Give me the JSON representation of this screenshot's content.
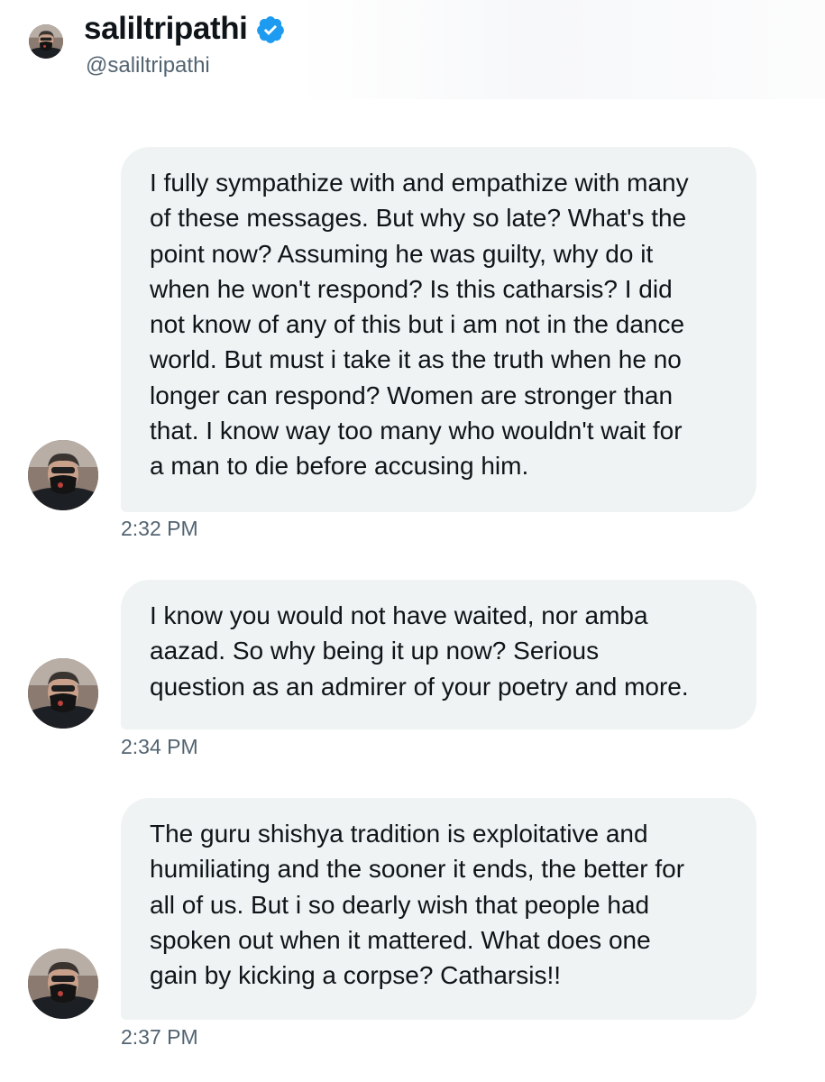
{
  "header": {
    "display_name": "saliltripathi",
    "handle": "@saliltripathi",
    "verified_icon": "verified-badge-icon"
  },
  "messages": [
    {
      "text": "I fully sympathize with and empathize with many\nof these messages. But why so late? What's the\npoint now? Assuming he was guilty, why do it\nwhen he won't respond? Is this catharsis? I did\nnot know of any of this but i am not in the dance\nworld. But must i take it as the truth when he no\nlonger can respond? Women are stronger than\nthat. I know way too many who wouldn't wait for\na man to die before accusing him.",
      "time": "2:32 PM"
    },
    {
      "text": "I know you would not have waited, nor amba\naazad. So why being it up now? Serious\nquestion as an admirer of your poetry and more.",
      "time": "2:34 PM"
    },
    {
      "text": "The guru shishya tradition is exploitative and\nhumiliating and the sooner it ends, the better for\nall of us. But i so dearly wish that people had\nspoken out when it mattered. What does one\ngain by kicking a corpse? Catharsis!!",
      "time": "2:37 PM"
    }
  ],
  "colors": {
    "bubble_background": "#eff3f4",
    "text_primary": "#0f1419",
    "text_secondary": "#536471",
    "verified_blue": "#1d9bf0"
  }
}
